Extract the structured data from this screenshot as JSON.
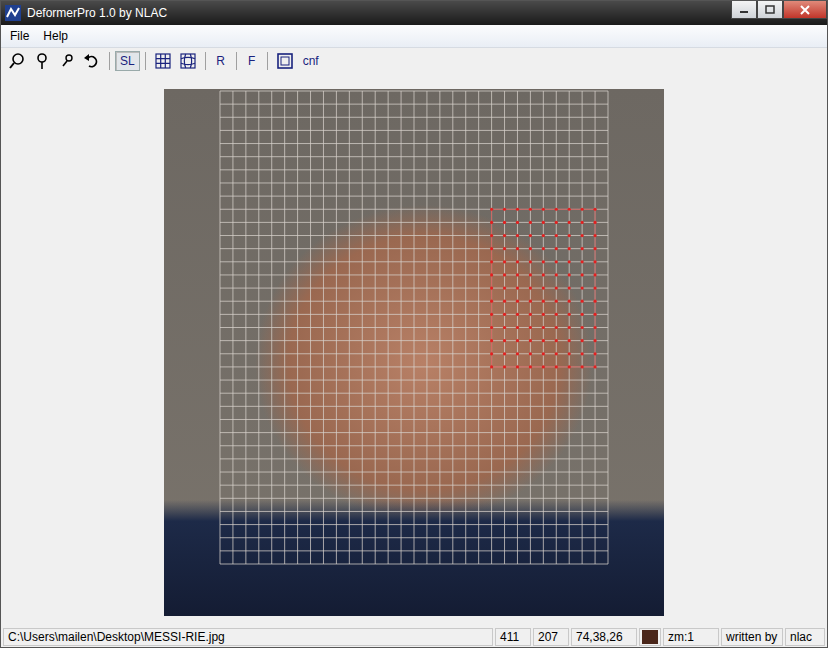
{
  "window": {
    "title": "DeformerPro 1.0 by NLAC",
    "controls": [
      "minimize",
      "maximize",
      "close"
    ]
  },
  "menu": [
    "File",
    "Help"
  ],
  "toolbar": [
    {
      "kind": "icon",
      "selected": false
    },
    {
      "kind": "icon",
      "selected": false
    },
    {
      "kind": "icon",
      "selected": false
    },
    {
      "kind": "icon",
      "selected": false
    },
    {
      "kind": "separator",
      "selected": false
    },
    {
      "kind": "text",
      "label": "SL",
      "selected": true
    },
    {
      "kind": "separator",
      "selected": false
    },
    {
      "kind": "icon",
      "selected": false
    },
    {
      "kind": "icon",
      "selected": false
    },
    {
      "kind": "separator",
      "selected": false
    },
    {
      "kind": "text",
      "label": "R",
      "selected": false
    },
    {
      "kind": "separator",
      "selected": false
    },
    {
      "kind": "text",
      "label": "F",
      "selected": false
    },
    {
      "kind": "separator",
      "selected": false
    },
    {
      "kind": "icon",
      "selected": false
    },
    {
      "kind": "text",
      "label": "cnf",
      "selected": false
    }
  ],
  "canvas": {
    "grid": {
      "visible": true,
      "columns": 30,
      "rows": 36
    },
    "selection": {
      "from_col": 21,
      "to_col": 29,
      "from_row": 9,
      "to_row": 21,
      "color": "#e02020"
    }
  },
  "status_bar": {
    "path": "C:\\Users\\mailen\\Desktop\\MESSI-RIE.jpg",
    "x": "411",
    "y": "207",
    "rgb": "74,38,26",
    "swatch_color": "#4a261a",
    "zoom": "zm:1",
    "credit_label": "written by",
    "credit": "nlac"
  }
}
